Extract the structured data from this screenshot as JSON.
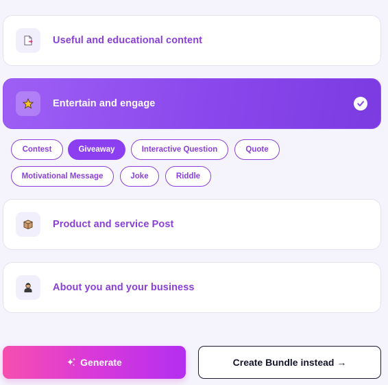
{
  "categories": [
    {
      "label": "Useful and educational content",
      "icon": "document-icon",
      "active": false
    },
    {
      "label": "Entertain and engage",
      "icon": "star-icon",
      "active": true
    },
    {
      "label": "Product and service Post",
      "icon": "package-icon",
      "active": false
    },
    {
      "label": "About you and your business",
      "icon": "person-icon",
      "active": false
    }
  ],
  "subtypes": [
    {
      "label": "Contest",
      "selected": false
    },
    {
      "label": "Giveaway",
      "selected": true
    },
    {
      "label": "Interactive Question",
      "selected": false
    },
    {
      "label": "Quote",
      "selected": false
    },
    {
      "label": "Motivational Message",
      "selected": false
    },
    {
      "label": "Joke",
      "selected": false
    },
    {
      "label": "Riddle",
      "selected": false
    }
  ],
  "actions": {
    "generate_label": "Generate",
    "generate_icon": "sparkle-icon",
    "bundle_label": "Create Bundle instead →"
  },
  "colors": {
    "accent": "#8c3ff0",
    "text_purple": "#8a3fd6",
    "background": "#f5f4fd",
    "generate_gradient_start": "#f64fae",
    "generate_gradient_end": "#b42ff0"
  }
}
